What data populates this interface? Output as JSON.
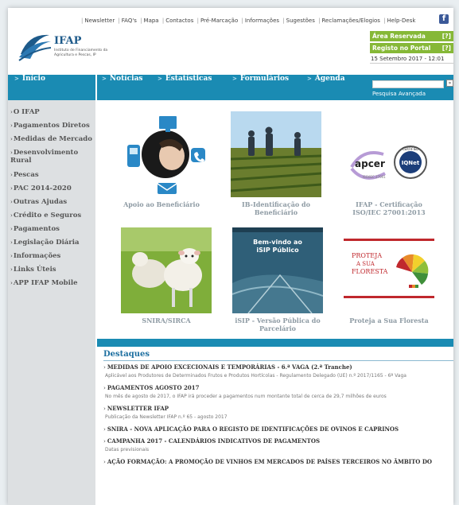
{
  "toplinks": [
    "Newsletter",
    "FAQ's",
    "Mapa",
    "Contactos",
    "Pré-Marcação",
    "Informações",
    "Sugestões",
    "Reclamações/Elogios",
    "Help-Desk"
  ],
  "header": {
    "logo_title": "IFAP",
    "logo_subtitle": "Instituto de Financiamento da Agricultura e Pescas, IP",
    "reserved_area": "Área Reservada",
    "portal_register": "Registo no Portal",
    "help_mark": "[?]",
    "date": "15 Setembro 2017 - 12:01"
  },
  "nav": {
    "items": [
      "Início",
      "Notícias",
      "Estatísticas",
      "Formulários",
      "Agenda"
    ],
    "search_advanced": "Pesquisa Avançada",
    "search_button": "»"
  },
  "sidebar": {
    "items": [
      "O IFAP",
      "Pagamentos Diretos",
      "Medidas de Mercado",
      "Desenvolvimento Rural",
      "Pescas",
      "PAC 2014-2020",
      "Outras Ajudas",
      "Crédito e Seguros",
      "Pagamentos",
      "Legislação Diária",
      "Informações",
      "Links Úteis",
      "APP IFAP Mobile"
    ]
  },
  "tiles": [
    {
      "caption": "Apoio ao Beneficiário"
    },
    {
      "caption": "IB-Identificação do Beneficiário"
    },
    {
      "caption": "IFAP - Certificação ISO/IEC 27001:2013",
      "logo_left": "apcer",
      "logo_right": "IQNet",
      "ring_text": "CERTIFIED",
      "iso": "ISO/IEC 27001"
    },
    {
      "caption": "SNIRA/SIRCA"
    },
    {
      "caption": "iSIP - Versão Pública do Parcelário",
      "banner": "Bem-vindo ao iSIP Público"
    },
    {
      "caption": "Proteja a Sua Floresta",
      "banner_lines": [
        "PROTEJA",
        "A SUA",
        "FLORESTA"
      ]
    }
  ],
  "destaques": {
    "title": "Destaques",
    "news": [
      {
        "title": "MEDIDAS DE APOIO EXCECIONAIS E TEMPORÁRIAS - 6.ª VAGA (2.ª Tranche)",
        "desc": "Aplicável aos Produtores de Determinados Frutos e Produtos Hortícolas - Regulamento Delegado (UE) n.º 2017/1165 - 6ª Vaga"
      },
      {
        "title": "PAGAMENTOS AGOSTO 2017",
        "desc": "No mês de agosto de 2017, o IFAP irá proceder a pagamentos num montante total de cerca de 29,7 milhões de euros"
      },
      {
        "title": "NEWSLETTER IFAP",
        "desc": "Publicação da Newsletter IFAP n.º 65 - agosto 2017"
      },
      {
        "title": "SNIRA - NOVA APLICAÇÃO PARA O REGISTO DE IDENTIFICAÇÕES DE OVINOS E CAPRINOS",
        "desc": ""
      },
      {
        "title": "CAMPANHA 2017 - CALENDÁRIOS INDICATIVOS DE PAGAMENTOS",
        "desc": "Datas previsionais"
      },
      {
        "title": "AÇÃO FORMAÇÃO: A PROMOÇÃO DE VINHOS EM MERCADOS DE PAÍSES TERCEIROS NO ÂMBITO DO",
        "desc": ""
      }
    ]
  },
  "colors": {
    "nav_blue": "#1a8bb3",
    "green": "#86b837",
    "sidebar_grey": "#dde0e2"
  }
}
